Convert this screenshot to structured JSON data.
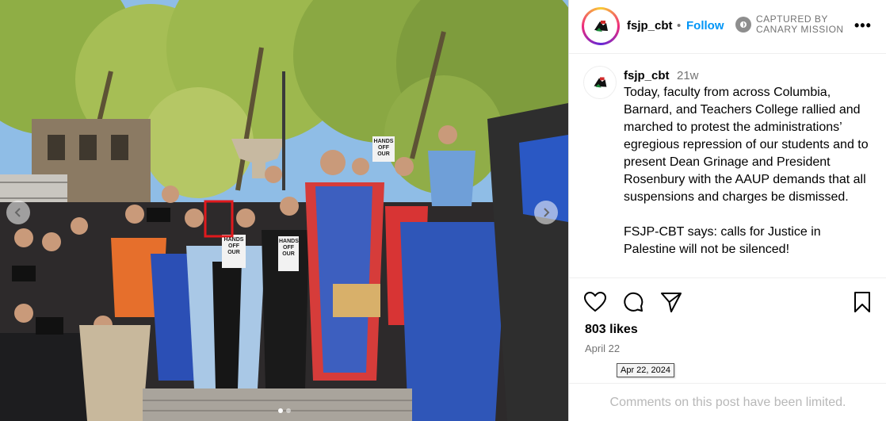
{
  "post": {
    "username": "fsjp_cbt",
    "follow_label": "Follow",
    "separator": "•",
    "captured_line1": "CAPTURED BY",
    "captured_line2": "CANARY MISSION",
    "more_label": "•••",
    "caption_username": "fsjp_cbt",
    "caption_time": "21w",
    "caption_text": "Today, faculty from across Columbia, Barnard, and Teachers College rallied and marched to protest the administrations’ egregious repression of our students and to present Dean Grinage and President Rosenbury with the AAUP demands that all suspensions and charges be dismissed.\n\nFSJP-CBT says: calls for Justice in Palestine will not be silenced!",
    "likes": "803 likes",
    "date": "April 22",
    "date_tooltip": "Apr 22, 2024",
    "comments_limited": "Comments on this post have been limited."
  },
  "photo": {
    "signs": [
      "HANDS OFF OUR",
      "HANDS OFF OUR",
      "HANDS OFF OUR"
    ],
    "highlight_color": "#e0191d"
  },
  "icons": {
    "like": "heart-icon",
    "comment": "comment-icon",
    "share": "send-icon",
    "save": "bookmark-icon",
    "carousel_prev": "chevron-left-icon",
    "carousel_next": "chevron-right-icon"
  },
  "colors": {
    "follow": "#0095f6",
    "muted": "#737373"
  }
}
